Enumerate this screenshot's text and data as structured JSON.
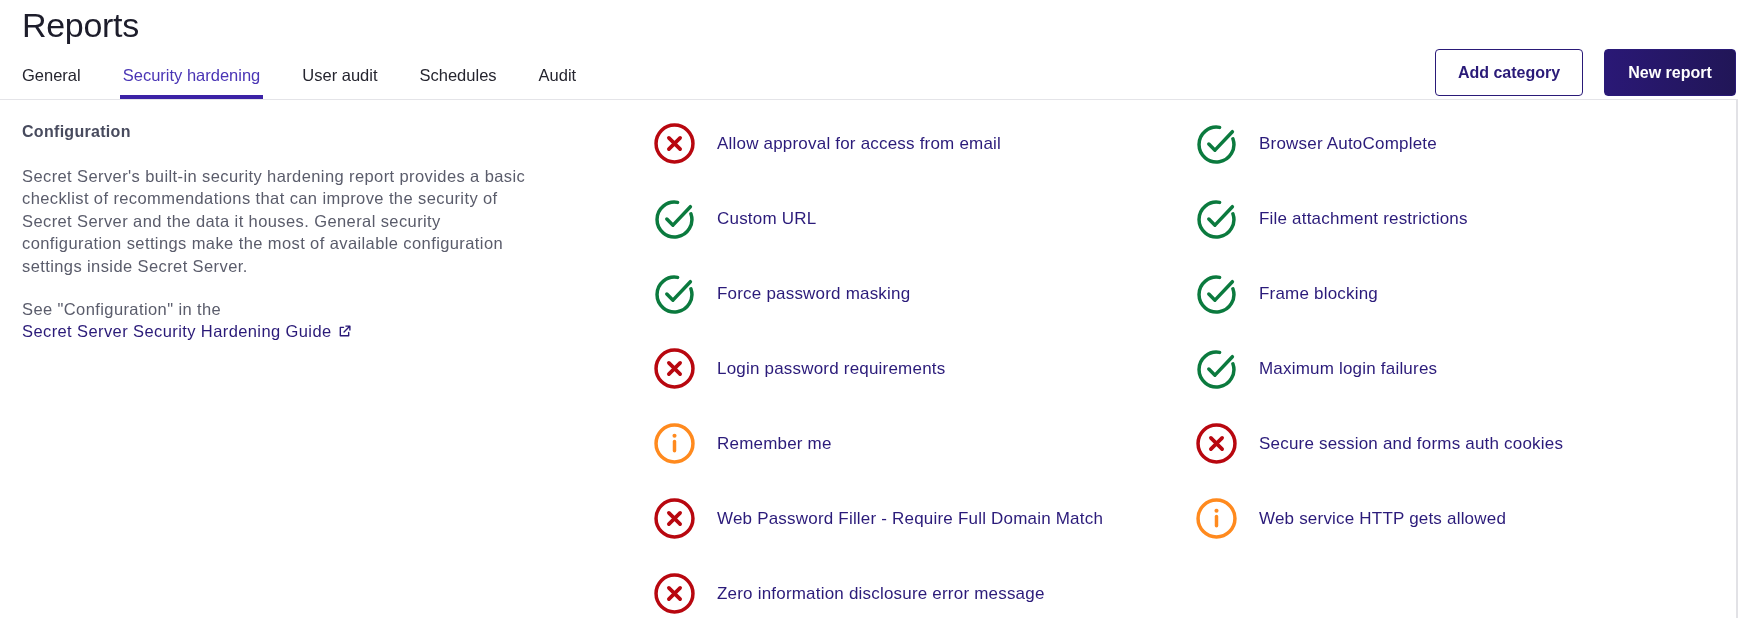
{
  "page": {
    "title": "Reports"
  },
  "tabs": [
    {
      "label": "General",
      "selected": false
    },
    {
      "label": "Security hardening",
      "selected": true
    },
    {
      "label": "User audit",
      "selected": false
    },
    {
      "label": "Schedules",
      "selected": false
    },
    {
      "label": "Audit",
      "selected": false
    }
  ],
  "actions": [
    {
      "label": "Add category",
      "kind": "secondary"
    },
    {
      "label": "New report",
      "kind": "primary"
    }
  ],
  "info_panel": {
    "heading": "Configuration",
    "description": "Secret Server's built-in security hardening report provides a basic checklist of recommendations that can improve the security of Secret Server and the data it houses. General security configuration settings make the most of available configuration settings inside Secret Server.",
    "reference_text": "See \"Configuration\" in the",
    "reference_link": "Secret Server Security Hardening Guide"
  },
  "checks": [
    {
      "label": "Allow approval for access from email",
      "kind": "fail"
    },
    {
      "label": "Browser AutoComplete",
      "kind": "pass"
    },
    {
      "label": "Custom URL",
      "kind": "pass"
    },
    {
      "label": "File attachment restrictions",
      "kind": "pass"
    },
    {
      "label": "Force password masking",
      "kind": "pass"
    },
    {
      "label": "Frame blocking",
      "kind": "pass"
    },
    {
      "label": "Login password requirements",
      "kind": "fail"
    },
    {
      "label": "Maximum login failures",
      "kind": "pass"
    },
    {
      "label": "Remember me",
      "kind": "warning"
    },
    {
      "label": "Secure session and forms auth cookies",
      "kind": "fail"
    },
    {
      "label": "Web Password Filler - Require Full Domain Match",
      "kind": "fail"
    },
    {
      "label": "Web service HTTP gets allowed",
      "kind": "warning"
    },
    {
      "label": "Zero information disclosure error message",
      "kind": "fail"
    }
  ]
}
